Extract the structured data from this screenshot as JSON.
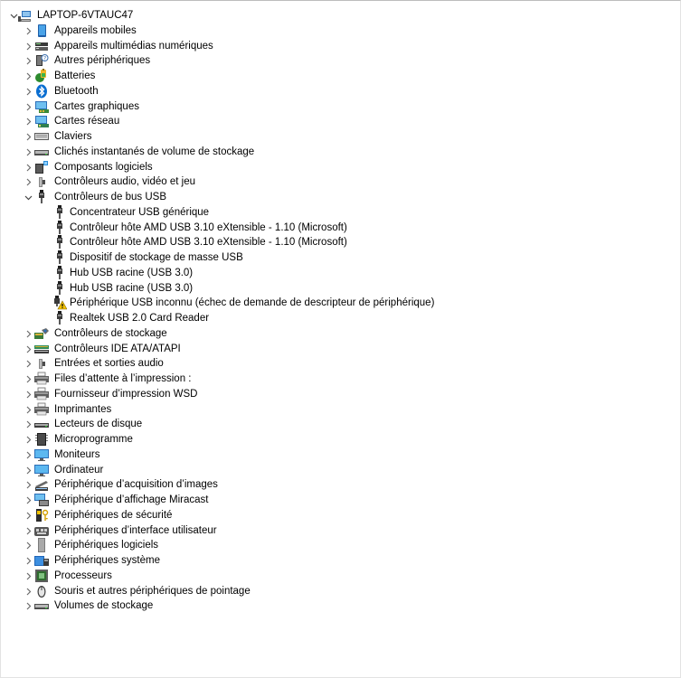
{
  "tree": {
    "root": {
      "label": "LAPTOP-6VTAUC47",
      "icon": "computer-icon",
      "expanded": true
    },
    "categories": [
      {
        "label": "Appareils mobiles",
        "icon": "mobile-device-icon",
        "expanded": false
      },
      {
        "label": "Appareils multimédias numériques",
        "icon": "multimedia-device-icon",
        "expanded": false
      },
      {
        "label": "Autres périphériques",
        "icon": "unknown-device-icon",
        "expanded": false
      },
      {
        "label": "Batteries",
        "icon": "battery-icon",
        "expanded": false
      },
      {
        "label": "Bluetooth",
        "icon": "bluetooth-icon",
        "expanded": false
      },
      {
        "label": "Cartes graphiques",
        "icon": "display-adapter-icon",
        "expanded": false
      },
      {
        "label": "Cartes réseau",
        "icon": "network-adapter-icon",
        "expanded": false
      },
      {
        "label": "Claviers",
        "icon": "keyboard-icon",
        "expanded": false
      },
      {
        "label": "Clichés instantanés de volume de stockage",
        "icon": "drive-icon",
        "expanded": false
      },
      {
        "label": "Composants logiciels",
        "icon": "software-component-icon",
        "expanded": false
      },
      {
        "label": "Contrôleurs audio, vidéo et jeu",
        "icon": "speaker-icon",
        "expanded": false
      },
      {
        "label": "Contrôleurs de bus USB",
        "icon": "usb-plug-icon",
        "expanded": true,
        "children": [
          {
            "label": "Concentrateur USB générique",
            "icon": "usb-plug-icon"
          },
          {
            "label": "Contrôleur hôte AMD USB 3.10 eXtensible - 1.10 (Microsoft)",
            "icon": "usb-plug-icon"
          },
          {
            "label": "Contrôleur hôte AMD USB 3.10 eXtensible - 1.10 (Microsoft)",
            "icon": "usb-plug-icon"
          },
          {
            "label": "Dispositif de stockage de masse USB",
            "icon": "usb-plug-icon"
          },
          {
            "label": "Hub USB racine (USB 3.0)",
            "icon": "usb-plug-icon"
          },
          {
            "label": "Hub USB racine (USB 3.0)",
            "icon": "usb-plug-icon"
          },
          {
            "label": "Périphérique USB inconnu (échec de demande de descripteur de périphérique)",
            "icon": "usb-warning-icon"
          },
          {
            "label": "Realtek USB 2.0 Card Reader",
            "icon": "usb-plug-icon"
          }
        ]
      },
      {
        "label": "Contrôleurs de stockage",
        "icon": "storage-controller-icon",
        "expanded": false
      },
      {
        "label": "Contrôleurs IDE ATA/ATAPI",
        "icon": "ide-controller-icon",
        "expanded": false
      },
      {
        "label": "Entrées et sorties audio",
        "icon": "speaker-icon",
        "expanded": false
      },
      {
        "label": "Files d’attente à l’impression :",
        "icon": "printer-icon",
        "expanded": false
      },
      {
        "label": "Fournisseur d’impression WSD",
        "icon": "printer-icon",
        "expanded": false
      },
      {
        "label": "Imprimantes",
        "icon": "printer-icon",
        "expanded": false
      },
      {
        "label": "Lecteurs de disque",
        "icon": "disk-drive-icon",
        "expanded": false
      },
      {
        "label": "Microprogramme",
        "icon": "firmware-icon",
        "expanded": false
      },
      {
        "label": "Moniteurs",
        "icon": "monitor-icon",
        "expanded": false
      },
      {
        "label": "Ordinateur",
        "icon": "monitor-icon",
        "expanded": false
      },
      {
        "label": "Périphérique d’acquisition d’images",
        "icon": "scanner-icon",
        "expanded": false
      },
      {
        "label": "Périphérique d’affichage Miracast",
        "icon": "miracast-icon",
        "expanded": false
      },
      {
        "label": "Périphériques de sécurité",
        "icon": "security-key-icon",
        "expanded": false
      },
      {
        "label": "Périphériques d’interface utilisateur",
        "icon": "hid-icon",
        "expanded": false
      },
      {
        "label": "Périphériques logiciels",
        "icon": "software-device-icon",
        "expanded": false
      },
      {
        "label": "Périphériques système",
        "icon": "system-device-icon",
        "expanded": false
      },
      {
        "label": "Processeurs",
        "icon": "processor-icon",
        "expanded": false
      },
      {
        "label": "Souris et autres périphériques de pointage",
        "icon": "mouse-icon",
        "expanded": false
      },
      {
        "label": "Volumes de stockage",
        "icon": "drive-icon",
        "expanded": false
      }
    ]
  }
}
